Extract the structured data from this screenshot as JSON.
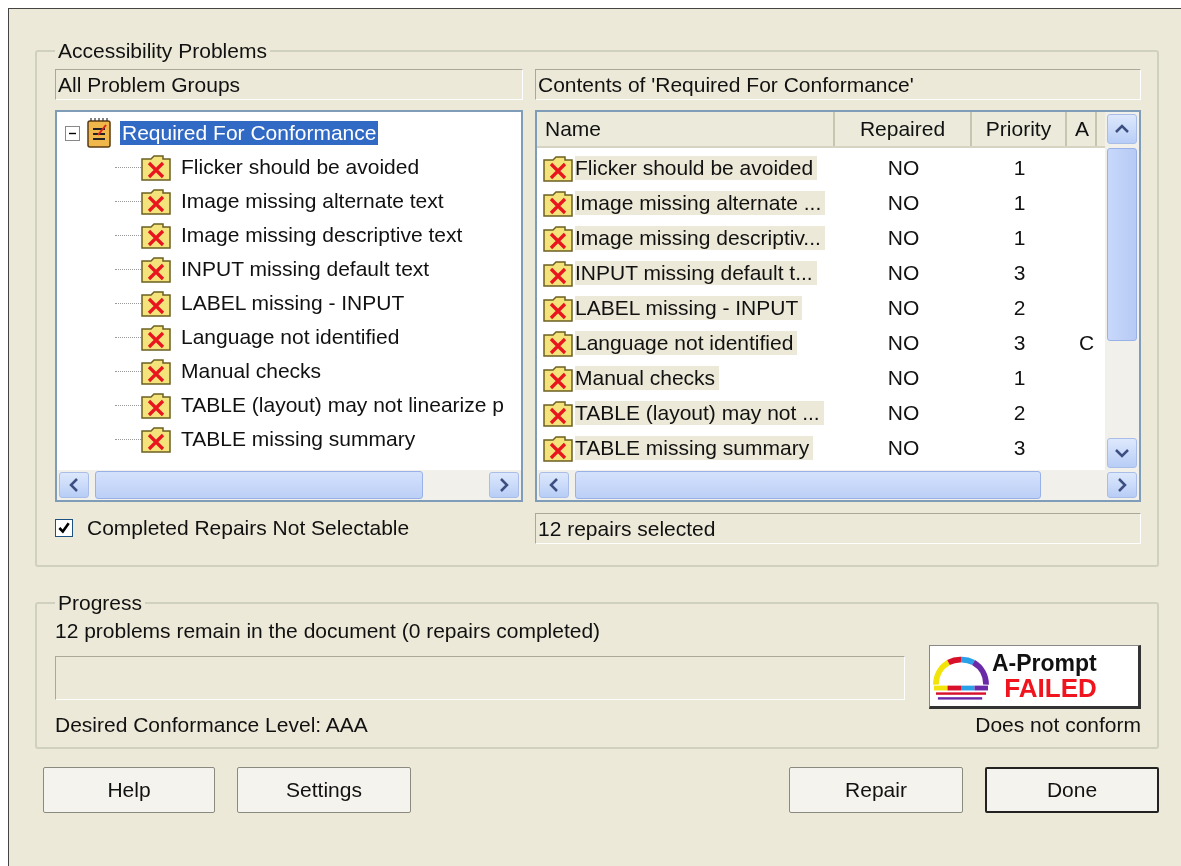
{
  "problems_group": {
    "title": "Accessibility Problems"
  },
  "tree_panel": {
    "header": "All Problem Groups",
    "root": {
      "label": "Required For Conformance",
      "selected": true,
      "expanded": true,
      "children": [
        {
          "label": "Flicker should be avoided"
        },
        {
          "label": "Image missing alternate text"
        },
        {
          "label": "Image missing descriptive text"
        },
        {
          "label": "INPUT missing default text"
        },
        {
          "label": "LABEL missing - INPUT"
        },
        {
          "label": "Language not identified"
        },
        {
          "label": "Manual checks"
        },
        {
          "label": "TABLE (layout) may not linearize p"
        },
        {
          "label": "TABLE missing summary"
        }
      ]
    }
  },
  "checkbox": {
    "label": "Completed Repairs Not Selectable",
    "checked": true
  },
  "contents_panel": {
    "header": "Contents of 'Required For Conformance'",
    "columns": [
      "Name",
      "Repaired",
      "Priority",
      "A"
    ],
    "rows": [
      {
        "name": "Flicker should be avoided",
        "repaired": "NO",
        "priority": "1",
        "selected": true
      },
      {
        "name": "Image missing alternate ...",
        "repaired": "NO",
        "priority": "1",
        "selected": true
      },
      {
        "name": "Image missing descriptiv...",
        "repaired": "NO",
        "priority": "1",
        "selected": true
      },
      {
        "name": "INPUT missing default t...",
        "repaired": "NO",
        "priority": "3",
        "selected": true
      },
      {
        "name": "LABEL missing - INPUT",
        "repaired": "NO",
        "priority": "2",
        "selected": true
      },
      {
        "name": "Language not identified",
        "repaired": "NO",
        "priority": "3",
        "column_4": "C",
        "selected": true
      },
      {
        "name": "Manual checks",
        "repaired": "NO",
        "priority": "1",
        "selected": true
      },
      {
        "name": "TABLE (layout) may not ...",
        "repaired": "NO",
        "priority": "2",
        "selected": true
      },
      {
        "name": "TABLE missing summary",
        "repaired": "NO",
        "priority": "3",
        "selected": true
      }
    ],
    "status": "12 repairs selected"
  },
  "progress_group": {
    "title": "Progress",
    "message": "12 problems remain in the document (0 repairs completed)",
    "conformance_level": "Desired Conformance Level: AAA",
    "badge": {
      "brand": "A-Prompt",
      "status": "FAILED"
    },
    "result": "Does not conform"
  },
  "left_buttons": [
    {
      "label": "Help",
      "default": false
    },
    {
      "label": "Settings",
      "default": false
    }
  ],
  "right_buttons": [
    {
      "label": "Repair",
      "default": false
    },
    {
      "label": "Done",
      "default": true
    }
  ]
}
